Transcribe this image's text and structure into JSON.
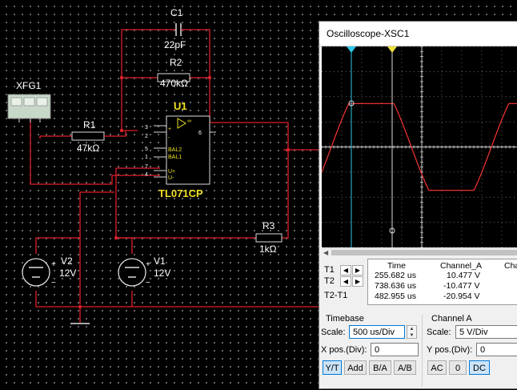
{
  "schematic": {
    "function_generator": "XFG1",
    "c1": {
      "ref": "C1",
      "value": "22pF"
    },
    "r2": {
      "ref": "R2",
      "value": "470kΩ"
    },
    "r1": {
      "ref": "R1",
      "value": "47kΩ"
    },
    "r3": {
      "ref": "R3",
      "value": "1kΩ"
    },
    "opamp": {
      "ref": "U1",
      "part": "TL071CP",
      "pins": {
        "p3": "3",
        "p2": "2",
        "p5": "5",
        "p1": "1",
        "p7": "7",
        "p4": "4",
        "p6": "6"
      },
      "pin_labels": {
        "bal2": "BAL2",
        "bal1": "BAL1",
        "vpos": "U+",
        "vneg": "U-",
        "plus": "+",
        "minus": "-",
        "inf": "∞"
      }
    },
    "v2": {
      "ref": "V2",
      "value": "12V"
    },
    "v1": {
      "ref": "V1",
      "value": "12V"
    }
  },
  "oscilloscope": {
    "title": "Oscilloscope-XSC1",
    "trace_color": "#e8312f",
    "cursor_color": "#30c8e8",
    "cursor2_color": "#f0e040",
    "cursor_table": {
      "headers": {
        "time": "Time",
        "channel_a": "Channel_A",
        "channel_b": "Cha"
      },
      "rows": [
        {
          "label": "T1",
          "time": "255.682 us",
          "channel_a": "10.477 V"
        },
        {
          "label": "T2",
          "time": "738.636 us",
          "channel_a": "-10.477 V"
        },
        {
          "label": "T2-T1",
          "time": "482.955 us",
          "channel_a": "-20.954 V"
        }
      ]
    },
    "timebase": {
      "section_label": "Timebase",
      "scale_label": "Scale:",
      "scale_value": "500 us/Div",
      "xpos_label": "X pos.(Div):",
      "xpos_value": "0",
      "buttons": [
        "Y/T",
        "Add",
        "B/A",
        "A/B"
      ]
    },
    "channel_a": {
      "section_label": "Channel A",
      "scale_label": "Scale:",
      "scale_value": "5 V/Div",
      "ypos_label": "Y pos.(Div):",
      "ypos_value": "0",
      "buttons": [
        "AC",
        "0",
        "DC"
      ]
    }
  }
}
